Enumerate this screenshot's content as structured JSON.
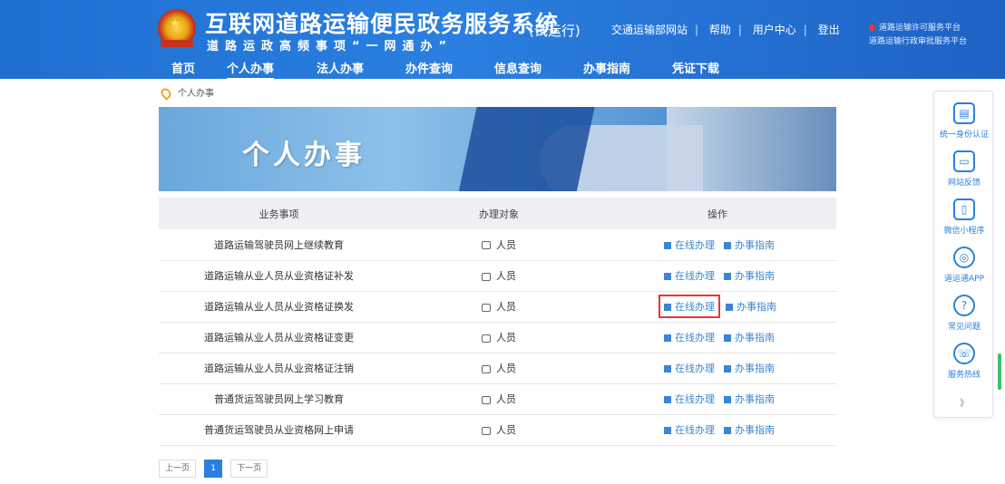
{
  "header": {
    "title": "互联网道路运输便民政务服务系统",
    "subtitle": "道路运政高频事项“一网通办”",
    "trial": "(试运行)",
    "top_links": [
      "交通运输部网站",
      "帮助",
      "用户中心",
      "登出"
    ],
    "right_links": [
      "道路运输许可服务平台",
      "道路运输行政审批服务平台"
    ]
  },
  "nav": {
    "items": [
      "首页",
      "个人办事",
      "法人办事",
      "办件查询",
      "信息查询",
      "办事指南",
      "凭证下载"
    ],
    "active": "个人办事"
  },
  "breadcrumb": "个人办事",
  "banner_title": "个人办事",
  "table": {
    "headers": [
      "业务事项",
      "办理对象",
      "操作"
    ],
    "rows": [
      {
        "item": "道路运输驾驶员网上继续教育",
        "target": "人员",
        "online": "在线办理",
        "guide": "办事指南"
      },
      {
        "item": "道路运输从业人员从业资格证补发",
        "target": "人员",
        "online": "在线办理",
        "guide": "办事指南"
      },
      {
        "item": "道路运输从业人员从业资格证换发",
        "target": "人员",
        "online": "在线办理",
        "guide": "办事指南"
      },
      {
        "item": "道路运输从业人员从业资格证变更",
        "target": "人员",
        "online": "在线办理",
        "guide": "办事指南"
      },
      {
        "item": "道路运输从业人员从业资格证注销",
        "target": "人员",
        "online": "在线办理",
        "guide": "办事指南"
      },
      {
        "item": "普通货运驾驶员网上学习教育",
        "target": "人员",
        "online": "在线办理",
        "guide": "办事指南"
      },
      {
        "item": "普通货运驾驶员从业资格网上申请",
        "target": "人员",
        "online": "在线办理",
        "guide": "办事指南"
      }
    ],
    "highlighted_row": 2
  },
  "pager": {
    "prev": "上一页",
    "current": "1",
    "next": "下一页"
  },
  "sidebar": {
    "items": [
      {
        "label": "统一身份认证",
        "icon": "document-icon"
      },
      {
        "label": "网站反馈",
        "icon": "chat-icon"
      },
      {
        "label": "微信小程序",
        "icon": "phone-icon"
      },
      {
        "label": "道运通APP",
        "icon": "wechat-icon"
      },
      {
        "label": "常见问题",
        "icon": "question-icon"
      },
      {
        "label": "服务热线",
        "icon": "telephone-icon"
      }
    ],
    "more": "》"
  },
  "colors": {
    "brand_blue": "#2a7fe0",
    "link_blue": "#3a86d4",
    "highlight_red": "#e53935"
  }
}
